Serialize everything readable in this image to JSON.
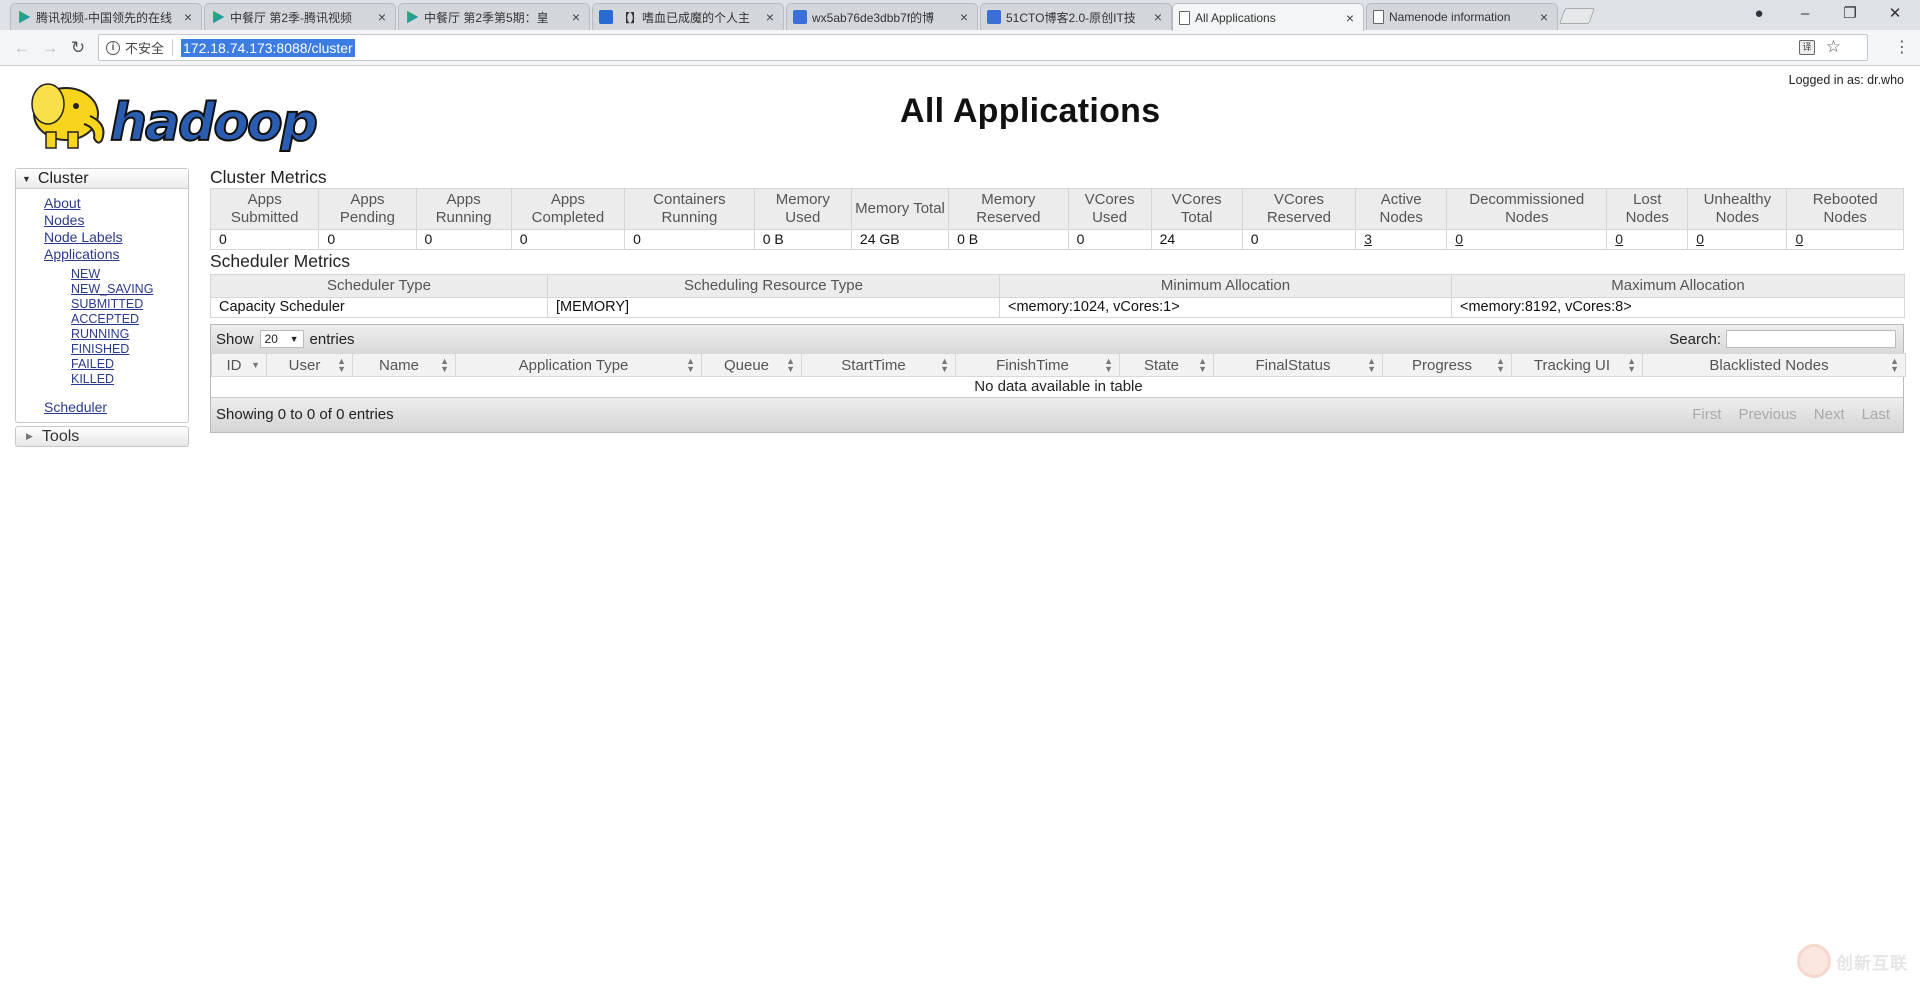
{
  "browser": {
    "tabs": [
      {
        "title": "腾讯视频-中国领先的在线",
        "icon": "play-icon"
      },
      {
        "title": "中餐厅 第2季-腾讯视频",
        "icon": "play-icon"
      },
      {
        "title": "中餐厅 第2季第5期：皇",
        "icon": "play-icon"
      },
      {
        "title": "【】嗜血已成魔的个人主",
        "icon": "home-icon"
      },
      {
        "title": "wx5ab76de3dbb7f的博",
        "icon": "pen-icon"
      },
      {
        "title": "51CTO博客2.0-原创IT技",
        "icon": "pen-icon"
      },
      {
        "title": "All Applications",
        "icon": "page-icon",
        "active": true
      },
      {
        "title": "Namenode information",
        "icon": "page-icon"
      }
    ],
    "tab_close": "×",
    "window_controls": {
      "minimize": "–",
      "maximize": "❐",
      "close": "✕"
    },
    "nav": {
      "back": "←",
      "forward": "→",
      "reload": "↻"
    },
    "security_label": "不安全",
    "url": "172.18.74.173:8088/cluster",
    "translate": "译",
    "star": "☆",
    "menu": "⋮"
  },
  "page": {
    "title": "All Applications",
    "logged_in": "Logged in as: dr.who",
    "logo_text": "hadoop"
  },
  "sidebar": {
    "cluster_label": "Cluster",
    "links": [
      "About",
      "Nodes",
      "Node Labels",
      "Applications"
    ],
    "app_states": [
      "NEW",
      "NEW_SAVING",
      "SUBMITTED",
      "ACCEPTED",
      "RUNNING",
      "FINISHED",
      "FAILED",
      "KILLED"
    ],
    "scheduler_label": "Scheduler",
    "tools_label": "Tools"
  },
  "cluster_metrics": {
    "title": "Cluster Metrics",
    "headers": [
      "Apps Submitted",
      "Apps Pending",
      "Apps Running",
      "Apps Completed",
      "Containers Running",
      "Memory Used",
      "Memory Total",
      "Memory Reserved",
      "VCores Used",
      "VCores Total",
      "VCores Reserved",
      "Active Nodes",
      "Decommissioned Nodes",
      "Lost Nodes",
      "Unhealthy Nodes",
      "Rebooted Nodes"
    ],
    "values": [
      "0",
      "0",
      "0",
      "0",
      "0",
      "0 B",
      "24 GB",
      "0 B",
      "0",
      "24",
      "0",
      "3",
      "0",
      "0",
      "0",
      "0"
    ]
  },
  "scheduler_metrics": {
    "title": "Scheduler Metrics",
    "headers": [
      "Scheduler Type",
      "Scheduling Resource Type",
      "Minimum Allocation",
      "Maximum Allocation"
    ],
    "values": [
      "Capacity Scheduler",
      "[MEMORY]",
      "<memory:1024, vCores:1>",
      "<memory:8192, vCores:8>"
    ]
  },
  "apps_table": {
    "show_label": "Show",
    "page_size": "20",
    "entries_label": "entries",
    "search_label": "Search:",
    "search_value": "",
    "columns": [
      "ID",
      "User",
      "Name",
      "Application Type",
      "Queue",
      "StartTime",
      "FinishTime",
      "State",
      "FinalStatus",
      "Progress",
      "Tracking UI",
      "Blacklisted Nodes"
    ],
    "empty_message": "No data available in table",
    "info": "Showing 0 to 0 of 0 entries",
    "pager": [
      "First",
      "Previous",
      "Next",
      "Last"
    ]
  },
  "watermark": "创新互联",
  "colors": {
    "link": "#2a3a8c",
    "url_highlight": "#3d7ce3",
    "header_bg": "#ececec"
  }
}
